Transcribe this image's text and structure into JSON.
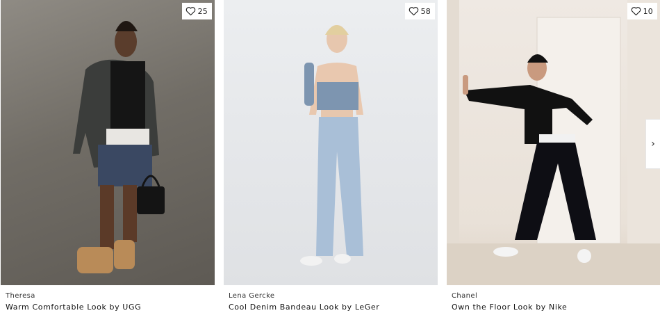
{
  "looks": [
    {
      "author": "Theresa",
      "title": "Warm Comfortable Look by UGG",
      "likes": "25",
      "like_icon": "heart-outline-icon"
    },
    {
      "author": "Lena Gercke",
      "title": "Cool Denim Bandeau Look by LeGer",
      "likes": "58",
      "like_icon": "heart-outline-icon"
    },
    {
      "author": "Chanel",
      "title": "Own the Floor Look by Nike",
      "likes": "10",
      "like_icon": "heart-outline-icon"
    }
  ],
  "carousel": {
    "next_icon": "chevron-right-icon",
    "next_glyph": "›"
  }
}
